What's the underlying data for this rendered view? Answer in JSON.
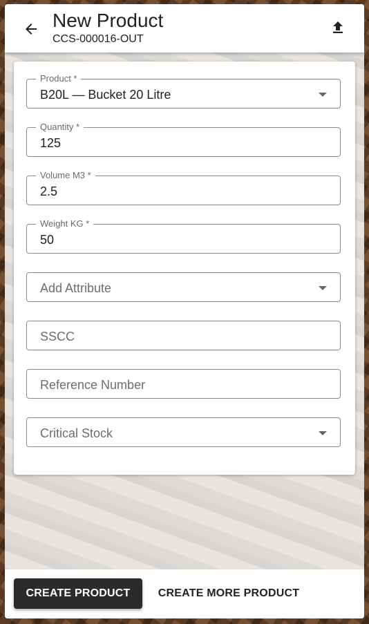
{
  "header": {
    "title": "New Product",
    "subtitle": "CCS-000016-OUT",
    "back_icon": "arrow-left-icon",
    "upload_icon": "upload-icon"
  },
  "form": {
    "product": {
      "label": "Product *",
      "value": "B20L — Bucket 20 Litre"
    },
    "quantity": {
      "label": "Quantity *",
      "value": "125"
    },
    "volume": {
      "label": "Volume M3 *",
      "value": "2.5"
    },
    "weight": {
      "label": "Weight KG *",
      "value": "50"
    },
    "attribute": {
      "placeholder": "Add Attribute"
    },
    "sscc": {
      "placeholder": "SSCC"
    },
    "reference": {
      "placeholder": "Reference Number"
    },
    "critical_stock": {
      "placeholder": "Critical Stock"
    }
  },
  "footer": {
    "create_label": "CREATE PRODUCT",
    "create_more_label": "CREATE MORE PRODUCT"
  },
  "colors": {
    "primary_button": "#2b2b2b",
    "header_bg": "#ffffff"
  }
}
